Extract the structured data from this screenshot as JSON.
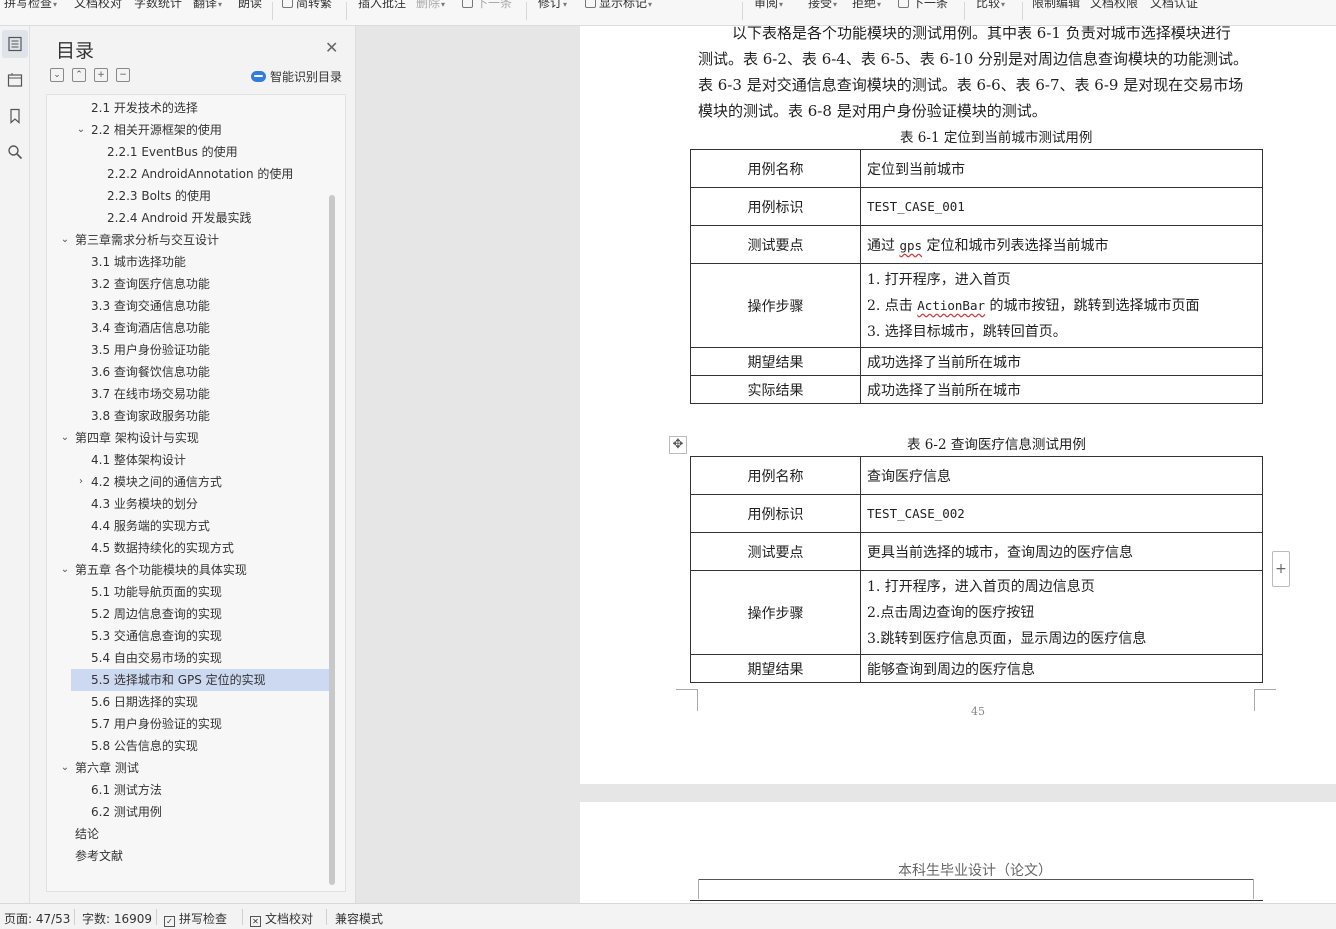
{
  "toolbar": {
    "items": [
      "拼写检查",
      "文档校对",
      "字数统计",
      "翻译",
      "朗读",
      "简转繁",
      "插入批注",
      "删除",
      "下一条",
      "修订",
      "显示标记",
      "审阅",
      "接受",
      "拒绝",
      "下一条",
      "比较",
      "限制编辑",
      "文档权限",
      "文档认证"
    ]
  },
  "toc": {
    "title": "目录",
    "smart_label": "智能识别目录",
    "items": [
      {
        "label": "2.1  开发技术的选择",
        "level": 2
      },
      {
        "label": "2.2  相关开源框架的使用",
        "level": 2,
        "arrow": "expanded"
      },
      {
        "label": "2.2.1 EventBus  的使用",
        "level": 3
      },
      {
        "label": "2.2.2 AndroidAnnotation  的使用",
        "level": 3
      },
      {
        "label": "2.2.3 Bolts  的使用",
        "level": 3
      },
      {
        "label": "2.2.4 Android  开发最实践",
        "level": 3
      },
      {
        "label": "第三章需求分析与交互设计",
        "level": 1,
        "arrow": "expanded"
      },
      {
        "label": "3.1  城市选择功能",
        "level": 2
      },
      {
        "label": "3.2  查询医疗信息功能",
        "level": 2
      },
      {
        "label": "3.3  查询交通信息功能",
        "level": 2
      },
      {
        "label": "3.4  查询酒店信息功能",
        "level": 2
      },
      {
        "label": "3.5  用户身份验证功能",
        "level": 2
      },
      {
        "label": "3.6  查询餐饮信息功能",
        "level": 2
      },
      {
        "label": "3.7  在线市场交易功能",
        "level": 2
      },
      {
        "label": "3.8  查询家政服务功能",
        "level": 2
      },
      {
        "label": "第四章  架构设计与实现",
        "level": 1,
        "arrow": "expanded"
      },
      {
        "label": "4.1  整体架构设计",
        "level": 2
      },
      {
        "label": "4.2  模块之间的通信方式",
        "level": 2,
        "arrow": "collapsed"
      },
      {
        "label": "4.3  业务模块的划分",
        "level": 2
      },
      {
        "label": "4.4  服务端的实现方式",
        "level": 2
      },
      {
        "label": "4.5  数据持续化的实现方式",
        "level": 2
      },
      {
        "label": "第五章  各个功能模块的具体实现",
        "level": 1,
        "arrow": "expanded"
      },
      {
        "label": "5.1  功能导航页面的实现",
        "level": 2
      },
      {
        "label": "5.2  周边信息查询的实现",
        "level": 2
      },
      {
        "label": "5.3  交通信息查询的实现",
        "level": 2
      },
      {
        "label": "5.4  自由交易市场的实现",
        "level": 2
      },
      {
        "label": "5.5  选择城市和 GPS  定位的实现",
        "level": 2,
        "selected": true
      },
      {
        "label": "5.6  日期选择的实现",
        "level": 2
      },
      {
        "label": "5.7  用户身份验证的实现",
        "level": 2
      },
      {
        "label": "5.8 公告信息的实现",
        "level": 2
      },
      {
        "label": "第六章  测试",
        "level": 1,
        "arrow": "expanded"
      },
      {
        "label": "6.1  测试方法",
        "level": 2
      },
      {
        "label": "6.2  测试用例",
        "level": 2
      },
      {
        "label": "结论",
        "level": 1
      },
      {
        "label": "参考文献",
        "level": 1
      }
    ]
  },
  "doc": {
    "intro_lines": [
      "以下表格是各个功能模块的测试用例。其中表 6-1 负责对城市选择模块进行",
      "测试。表 6-2、表 6-4、表 6-5、表 6-10 分别是对周边信息查询模块的功能测试。",
      "表 6-3 是对交通信息查询模块的测试。表 6-6、表 6-7、表 6-9 是对现在交易市场",
      "模块的测试。表 6-8 是对用户身份验证模块的测试。"
    ],
    "table1": {
      "caption": "表 6-1   定位到当前城市测试用例",
      "name_key": "用例名称",
      "name_val": "定位到当前城市",
      "id_key": "用例标识",
      "id_val": "TEST_CASE_001",
      "point_key": "测试要点",
      "point_pre": "通过 ",
      "point_ul": "gps",
      "point_post": " 定位和城市列表选择当前城市",
      "steps_key": "操作步骤",
      "step1": "1.  打开程序，进入首页",
      "step2_pre": "2.    点击 ",
      "step2_ul": "ActionBar",
      "step2_post": " 的城市按钮，跳转到选择城市页面",
      "step3": "3.  选择目标城市，跳转回首页。",
      "expect_key": "期望结果",
      "expect_val": "成功选择了当前所在城市",
      "actual_key": "实际结果",
      "actual_val": "成功选择了当前所在城市"
    },
    "table2": {
      "caption": "表 6-2   查询医疗信息测试用例",
      "name_key": "用例名称",
      "name_val": "查询医疗信息",
      "id_key": "用例标识",
      "id_val": "TEST_CASE_002",
      "point_key": "测试要点",
      "point_val": "更具当前选择的城市，查询周边的医疗信息",
      "steps_key": "操作步骤",
      "step1": "1.  打开程序，进入首页的周边信息页",
      "step2": "2.点击周边查询的医疗按钮",
      "step3": "3.跳转到医疗信息页面，显示周边的医疗信息",
      "expect_key": "期望结果",
      "expect_val": "能够查询到周边的医疗信息"
    },
    "page_number": "45",
    "page2_header": "本科生毕业设计（论文）"
  },
  "status": {
    "page": "页面: 47/53",
    "words": "字数: 16909",
    "spell": "拼写检查",
    "proof": "文档校对",
    "compat": "兼容模式"
  }
}
